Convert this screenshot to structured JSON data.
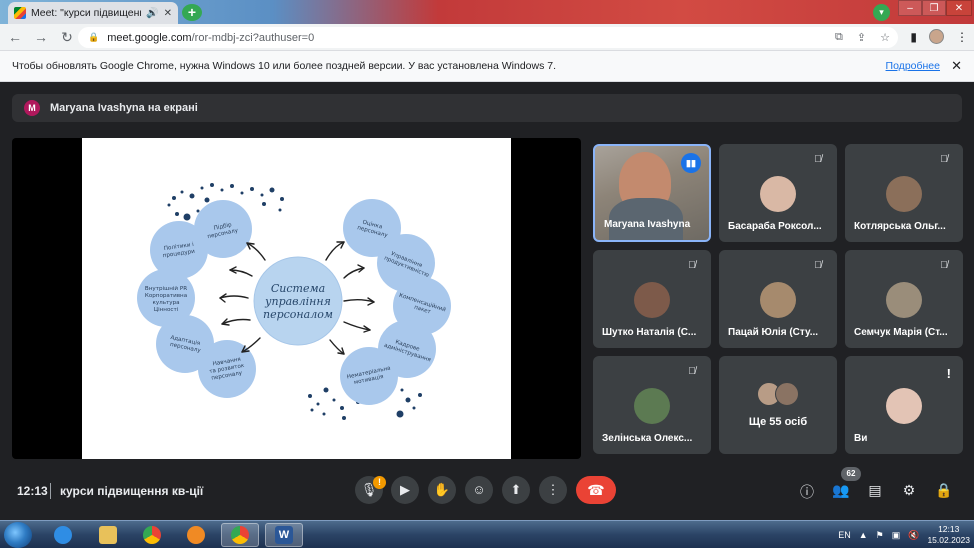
{
  "browser": {
    "tab_title": "Meet: \"курси підвищення кв",
    "url_host": "meet.google.com",
    "url_path": "/ror-mdbj-zci?authuser=0",
    "info_message": "Чтобы обновлять Google Chrome, нужна Windows 10 или более поздней версии. У вас установлена Windows 7.",
    "info_link": "Подробнее"
  },
  "meet": {
    "presenter_initial": "M",
    "presenting_text": "Maryana Ivashyna на екрані",
    "time": "12:13",
    "meeting_name": "курси підвищення кв-ції",
    "participant_count": "62",
    "more_count_label": "Ще 55 осіб"
  },
  "participants": [
    {
      "name": "Maryana Ivashyna",
      "color": "#c38a6e"
    },
    {
      "name": "Басараба Роксол...",
      "color": "#d9b8a5"
    },
    {
      "name": "Котлярська Ольг...",
      "color": "#8b6f5a"
    },
    {
      "name": "Шутко Наталія (С...",
      "color": "#7d5a4a"
    },
    {
      "name": "Пацай Юлія (Сту...",
      "color": "#a68a6d"
    },
    {
      "name": "Семчук Марія (Ст...",
      "color": "#9a8d7a"
    },
    {
      "name": "Зелінська Олекс...",
      "color": "#5c7a52"
    },
    {
      "name": "Ви",
      "color": "#e3c4b5"
    }
  ],
  "slide": {
    "center": [
      "Система",
      "управління",
      "персоналом"
    ],
    "bubbles": [
      [
        "Підбір",
        "персоналу"
      ],
      [
        "Політики і",
        "процедури"
      ],
      [
        "Внутрішній PR",
        "Корпоративна",
        "культура",
        "Цінності"
      ],
      [
        "Адаптація",
        "персоналу"
      ],
      [
        "Навчання",
        "та розвиток",
        "персоналу"
      ],
      [
        "Оцінка",
        "персоналу"
      ],
      [
        "Управління",
        "продуктивністю"
      ],
      [
        "Компенсаційний",
        "пакет"
      ],
      [
        "Кадрове",
        "адміністрування"
      ],
      [
        "Нематеріальна",
        "мотивація"
      ]
    ]
  },
  "taskbar": {
    "lang": "EN",
    "time": "12:13",
    "date": "15.02.2023"
  }
}
